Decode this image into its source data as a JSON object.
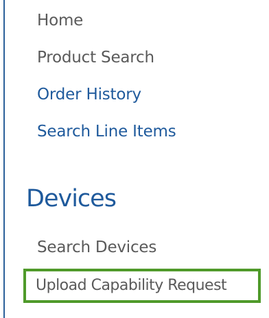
{
  "colors": {
    "border": "#2a5f99",
    "link_gray": "#5a5a5a",
    "link_blue": "#1f5a9c",
    "highlight": "#4f9a2a"
  },
  "nav": {
    "items": [
      {
        "label": "Home"
      },
      {
        "label": "Product Search"
      },
      {
        "label": "Order History"
      },
      {
        "label": "Search Line Items"
      }
    ]
  },
  "devices": {
    "heading": "Devices",
    "items": [
      {
        "label": "Search Devices"
      },
      {
        "label": "Upload Capability Request",
        "highlighted": true
      }
    ]
  }
}
